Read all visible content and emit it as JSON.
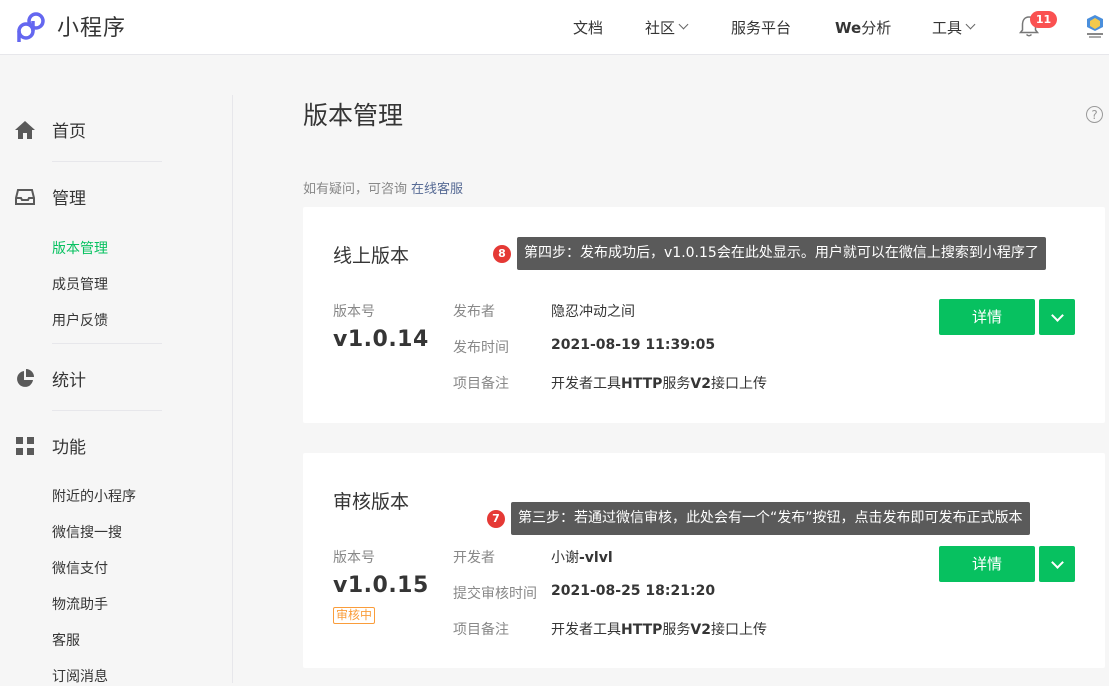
{
  "header": {
    "title": "小程序",
    "nav": {
      "docs": "文档",
      "community": "社区",
      "service_platform": "服务平台",
      "we_prefix": "We",
      "we_suffix": "分析",
      "tools": "工具"
    },
    "notification_count": "11",
    "logo_icon": "mini-program-logo-icon",
    "accent_color": "#07c160"
  },
  "sidebar": {
    "home": "首页",
    "manage": "管理",
    "manage_items": [
      "版本管理",
      "成员管理",
      "用户反馈"
    ],
    "stats": "统计",
    "features": "功能",
    "feature_items": [
      "附近的小程序",
      "微信搜一搜",
      "微信支付",
      "物流助手",
      "客服",
      "订阅消息"
    ]
  },
  "main": {
    "title": "版本管理",
    "help": "?",
    "consult_prefix": "如有疑问，可咨询",
    "consult_link": "在线客服",
    "online": {
      "title": "线上版本",
      "version_label": "版本号",
      "version": "v1.0.14",
      "publisher_label": "发布者",
      "publisher": "隐忍冲动之间",
      "time_label": "发布时间",
      "time": "2021-08-19 11:39:05",
      "note_label": "项目备注",
      "note_a": "开发者工具",
      "note_b": "HTTP",
      "note_c": "服务",
      "note_d": "V2",
      "note_e": "接口上传",
      "detail_button": "详情",
      "tip_number": "8",
      "tip_text": "第四步：发布成功后，v1.0.15会在此处显示。用户就可以在微信上搜索到小程序了"
    },
    "review": {
      "title": "审核版本",
      "version_label": "版本号",
      "version": "v1.0.15",
      "status": "审核中",
      "developer_label": "开发者",
      "developer_a": "小谢",
      "developer_b": "-vlvl",
      "time_label": "提交审核时间",
      "time": "2021-08-25 18:21:20",
      "note_label": "项目备注",
      "note_a": "开发者工具",
      "note_b": "HTTP",
      "note_c": "服务",
      "note_d": "V2",
      "note_e": "接口上传",
      "detail_button": "详情",
      "tip_number": "7",
      "tip_text": "第三步：若通过微信审核，此处会有一个“发布”按钮，点击发布即可发布正式版本"
    }
  }
}
